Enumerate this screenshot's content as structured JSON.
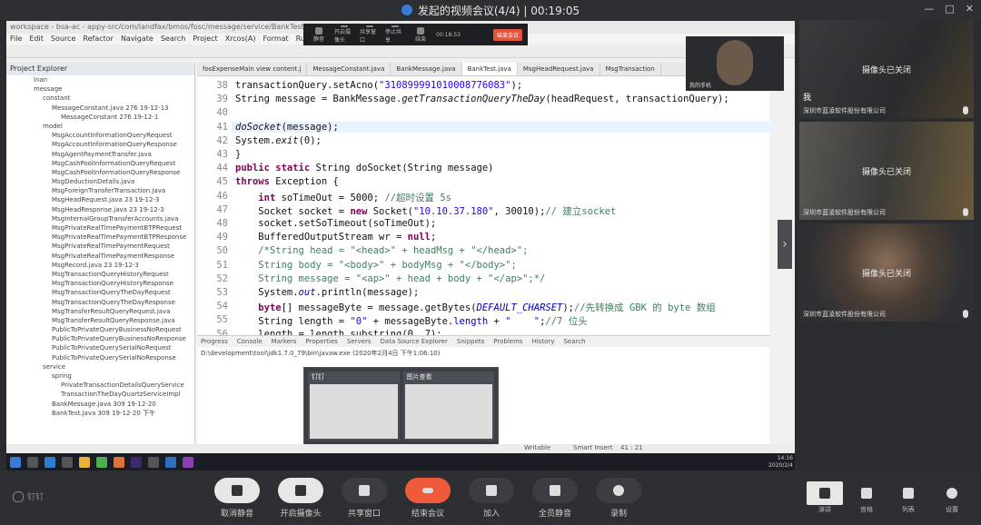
{
  "window": {
    "title": "发起的视频会议(4/4) | 00:19:05"
  },
  "ide": {
    "title": "workspace - bsa-ac - appy-src/com/landfax/bmos/fosc/message/service/BankTest.java - Eclipse",
    "menu": [
      "File",
      "Edit",
      "Source",
      "Refactor",
      "Navigate",
      "Search",
      "Project",
      "Xrcos(A)",
      "Format",
      "Run",
      "Window"
    ],
    "explorer_title": "Project Explorer",
    "tree": [
      "lnan",
      "message",
      "constant",
      "MessageConstant.java 276 19-12-13",
      "MessageConstant 276 19-12-1",
      "model",
      "MsgAccountInformationQueryRequest",
      "MsgAccountInformationQueryResponse",
      "MsgAgentPaymentTransfer.java",
      "MsgCashPoolInformationQueryRequest",
      "MsgCashPoolInformationQueryResponse",
      "MsgDeductionDetails.java",
      "MsgForeignTransferTransaction.java",
      "MsgHeadRequest.java 23 19-12-3",
      "MsgHeadResponse.java 23 19-12-3",
      "MsgInternalGroupTransferAccounts.java",
      "MsgPrivateRealTimePaymentBTPRequest",
      "MsgPrivateRealTimePaymentBTPResponse",
      "MsgPrivateRealTimePaymentRequest",
      "MsgPrivateRealTimePaymentResponse",
      "MsgRecord.java 23 19-12-3",
      "MsgTransactionQueryHistoryRequest",
      "MsgTransactionQueryHistoryResponse",
      "MsgTransactionQueryTheDayRequest",
      "MsgTransactionQueryTheDayResponse",
      "MsgTransferResultQueryRequest.java",
      "MsgTransferResultQueryResponse.java",
      "PublicToPrivateQueryBusinessNoRequest",
      "PublicToPrivateQueryBusinessNoResponse",
      "PublicToPrivateQuerySerialNoRequest",
      "PublicToPrivateQuerySerialNoResponse",
      "service",
      "spring",
      "PrivateTransactionDetailsQueryService",
      "TransactionTheDayQuartzServiceImpl",
      "BankMessage.java 309 19-12-20",
      "BankTest.java 309 19-12-20 下午"
    ],
    "tabs": [
      "fosExpenseMain view content.j",
      "MessageConstant.java",
      "BankMessage.java",
      "BankTest.java",
      "MsgHeadRequest.java",
      "MsgTransaction"
    ],
    "console_tabs": [
      "Progress",
      "Console",
      "Markers",
      "Properties",
      "Servers",
      "Data Source Explorer",
      "Snippets",
      "Problems",
      "History",
      "Search"
    ],
    "console_path": "D:\\development\\tool\\jdk1.7.0_79\\bin\\javaw.exe (2020年2月4日 下午1:06:10)",
    "status": [
      "Writable",
      "Smart Insert",
      "41 : 21"
    ]
  },
  "code_lines": [
    {
      "n": "38",
      "html": "transactionQuery.setAcno(<span class='str'>\"310899991010008776083\"</span>);"
    },
    {
      "n": "39",
      "html": "String message = BankMessage.<span class='fn'>getTransactionQueryTheDay</span>(headRequest, transactionQuery);"
    },
    {
      "n": "40",
      "html": ""
    },
    {
      "n": "41",
      "html": "<span class='fn'>doSocket</span>(message);",
      "hl": true
    },
    {
      "n": "42",
      "html": "System.<span class='fn'>exit</span>(0);"
    },
    {
      "n": "43",
      "html": "}"
    },
    {
      "n": "44",
      "html": "<span class='kw'>public static</span> String doSocket(String message)"
    },
    {
      "n": "45",
      "html": "<span class='kw'>throws</span> Exception {"
    },
    {
      "n": "46",
      "html": "    <span class='kw'>int</span> soTimeOut = 5000; <span class='cm'>//超时设置 5s</span>"
    },
    {
      "n": "47",
      "html": "    Socket socket = <span class='kw'>new</span> Socket(<span class='str'>\"10.10.37.180\"</span>, 30010);<span class='cm'>// 建立socket</span>"
    },
    {
      "n": "48",
      "html": "    socket.setSoTimeout(soTimeOut);"
    },
    {
      "n": "49",
      "html": "    BufferedOutputStream wr = <span class='kw'>null</span>;"
    },
    {
      "n": "50",
      "html": "    <span class='cm'>/*String head = \"&lt;head&gt;\" + headMsg + \"&lt;/head&gt;\";</span>"
    },
    {
      "n": "51",
      "html": "    <span class='cm'>String body = \"&lt;body&gt;\" + bodyMsg + \"&lt;/body&gt;\";</span>"
    },
    {
      "n": "52",
      "html": "    <span class='cm'>String message = \"&lt;ap&gt;\" + head + body + \"&lt;/ap&gt;\";*/</span>"
    },
    {
      "n": "53",
      "html": "    System.<span class='cst'>out</span>.println(message);"
    },
    {
      "n": "54",
      "html": "    <span class='kw'>byte</span>[] messageByte = message.getBytes(<span class='cst'>DEFAULT_CHARSET</span>);<span class='cm'>//先转换成 GBK 的 byte 数组</span>"
    },
    {
      "n": "55",
      "html": "    String length = <span class='str'>\"0\"</span> + messageByte.<span class='fld'>length</span> + <span class='str'>\"    \"</span>;<span class='cm'>//7 位头</span>"
    },
    {
      "n": "56",
      "html": "    length = length.substring(0, 7);"
    }
  ],
  "thumbnails": [
    {
      "title": "钉钉"
    },
    {
      "title": "图片查看"
    }
  ],
  "meeting_float": {
    "buttons": [
      "静音",
      "开启摄像头",
      "共享窗口",
      "停止共享",
      "结束"
    ],
    "timer": "00:18:53",
    "end": "结束会议"
  },
  "self_cam": {
    "label": "我的手机"
  },
  "participants": [
    {
      "name": "我",
      "org": "深圳市蓝凌软件股份有限公司",
      "status": "摄像头已关闭"
    },
    {
      "name": "",
      "org": "深圳市蓝凌软件股份有限公司",
      "status": "摄像头已关闭"
    },
    {
      "name": "",
      "org": "深圳市蓝凌软件股份有限公司",
      "status": "摄像头已关闭"
    }
  ],
  "taskbar": {
    "time": "14:16",
    "date": "2020/2/4"
  },
  "brand": "钉钉",
  "toolbar": {
    "mute": "取消静音",
    "camera": "开启摄像头",
    "share": "共享窗口",
    "end": "结束会议",
    "join": "加入",
    "mute_all": "全员静音",
    "record": "录制",
    "layouts": [
      "演讲",
      "宫格",
      "列表"
    ],
    "settings": "设置"
  }
}
